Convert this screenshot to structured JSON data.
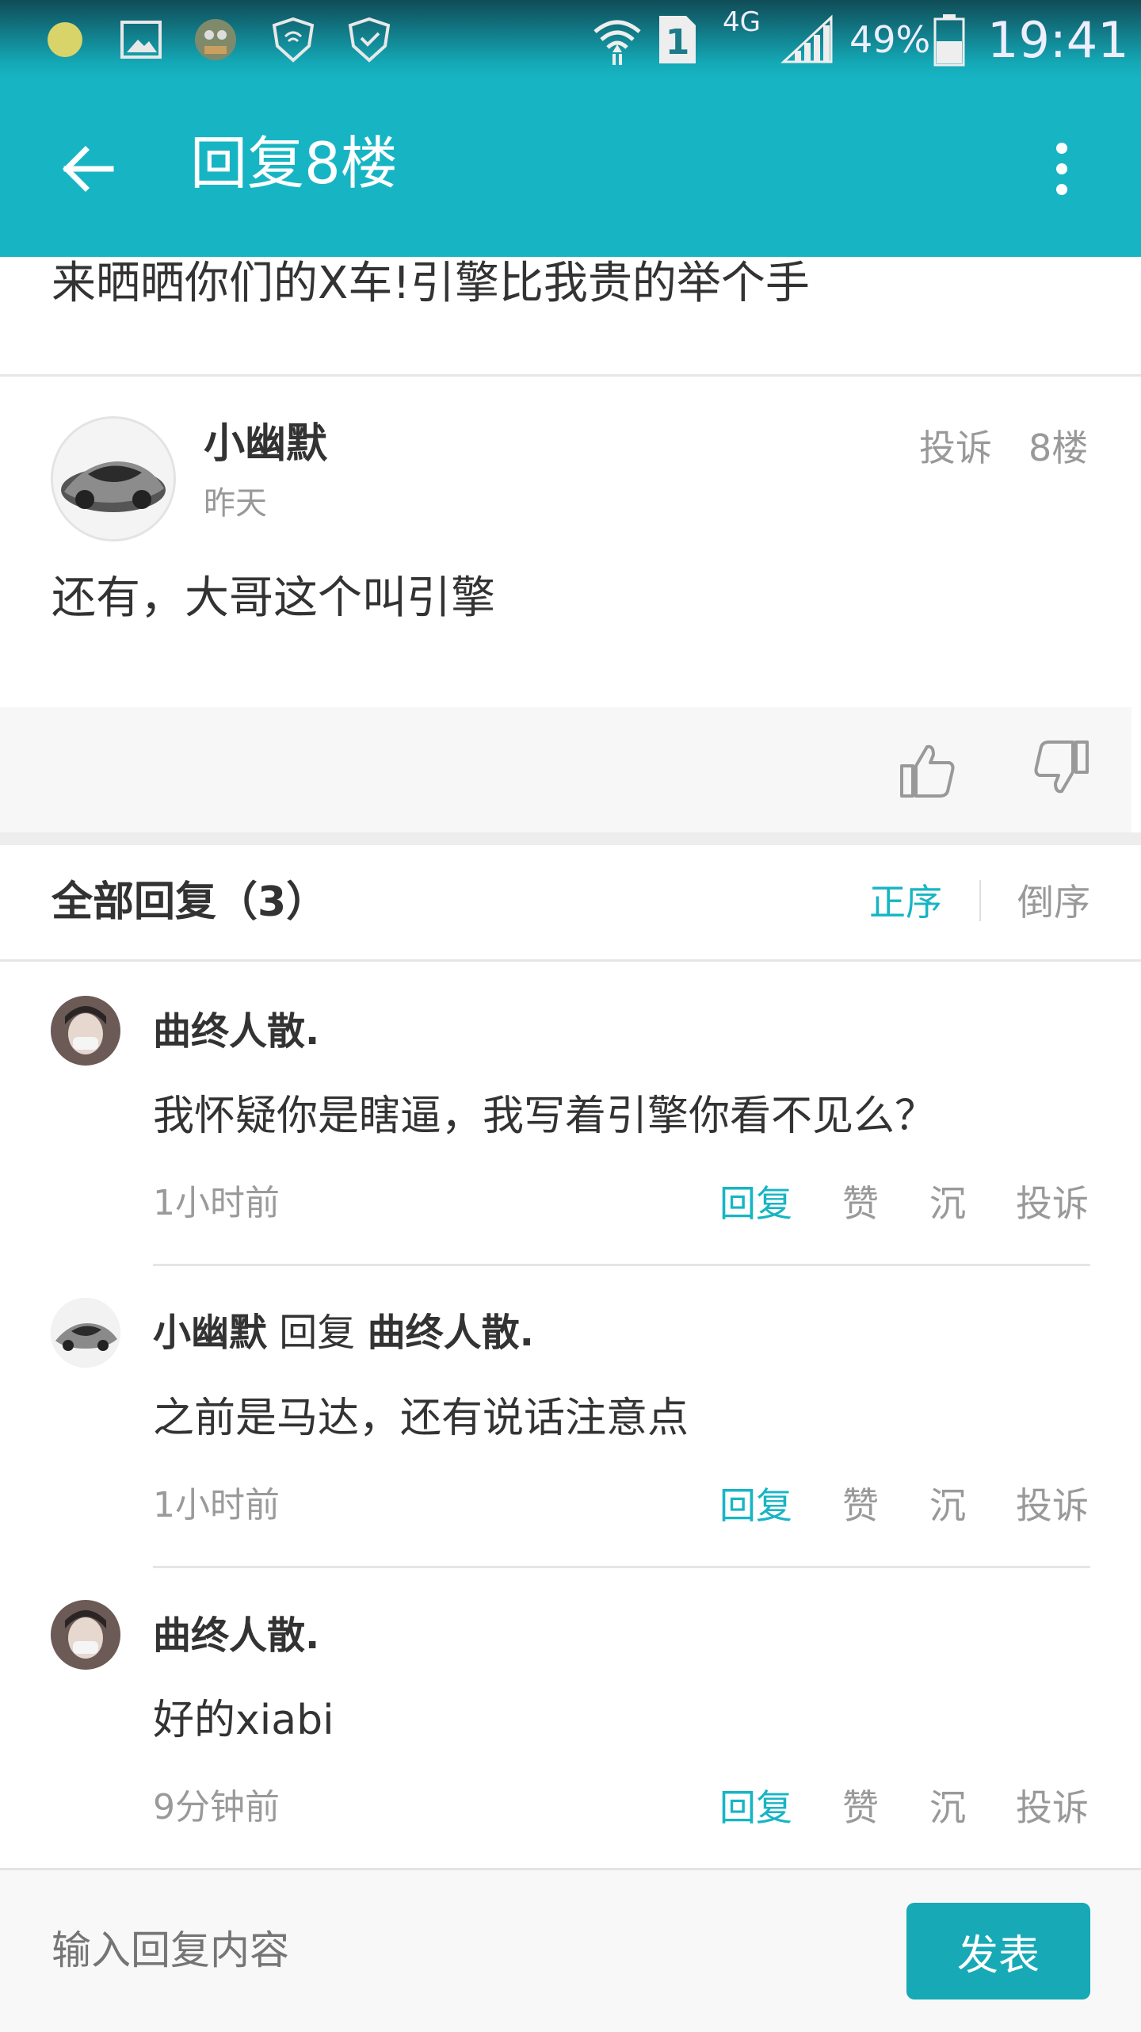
{
  "status_bar": {
    "battery": "49%",
    "time": "19:41",
    "network": "4G",
    "sim_slot": "1"
  },
  "app_bar": {
    "title": "回复8楼",
    "back_icon": "back-arrow-icon",
    "menu_icon": "more-vertical-icon"
  },
  "topic": {
    "title": "来晒晒你们的X车!引擎比我贵的举个手"
  },
  "floor": {
    "username": "小幽默",
    "time": "昨天",
    "report_label": "投诉",
    "floor_label": "8楼",
    "content": "还有，大哥这个叫引擎"
  },
  "replies_header": {
    "title": "全部回复（3）",
    "sort_asc": "正序",
    "sort_desc": "倒序"
  },
  "replies": [
    {
      "author": "曲终人散.",
      "reply_word": "",
      "reply_to": "",
      "text": "我怀疑你是瞎逼，我写着引擎你看不见么？",
      "time": "1小时前",
      "actions": {
        "reply": "回复",
        "like": "赞",
        "sink": "沉",
        "report": "投诉"
      }
    },
    {
      "author": "小幽默",
      "reply_word": "回复",
      "reply_to": "曲终人散.",
      "text": "之前是马达，还有说话注意点",
      "time": "1小时前",
      "actions": {
        "reply": "回复",
        "like": "赞",
        "sink": "沉",
        "report": "投诉"
      }
    },
    {
      "author": "曲终人散.",
      "reply_word": "",
      "reply_to": "",
      "text": "好的xiabi",
      "time": "9分钟前",
      "actions": {
        "reply": "回复",
        "like": "赞",
        "sink": "沉",
        "report": "投诉"
      }
    }
  ],
  "input_bar": {
    "placeholder": "输入回复内容",
    "send_label": "发表"
  },
  "colors": {
    "accent": "#17b5c4",
    "send_button": "#17a9b6"
  }
}
